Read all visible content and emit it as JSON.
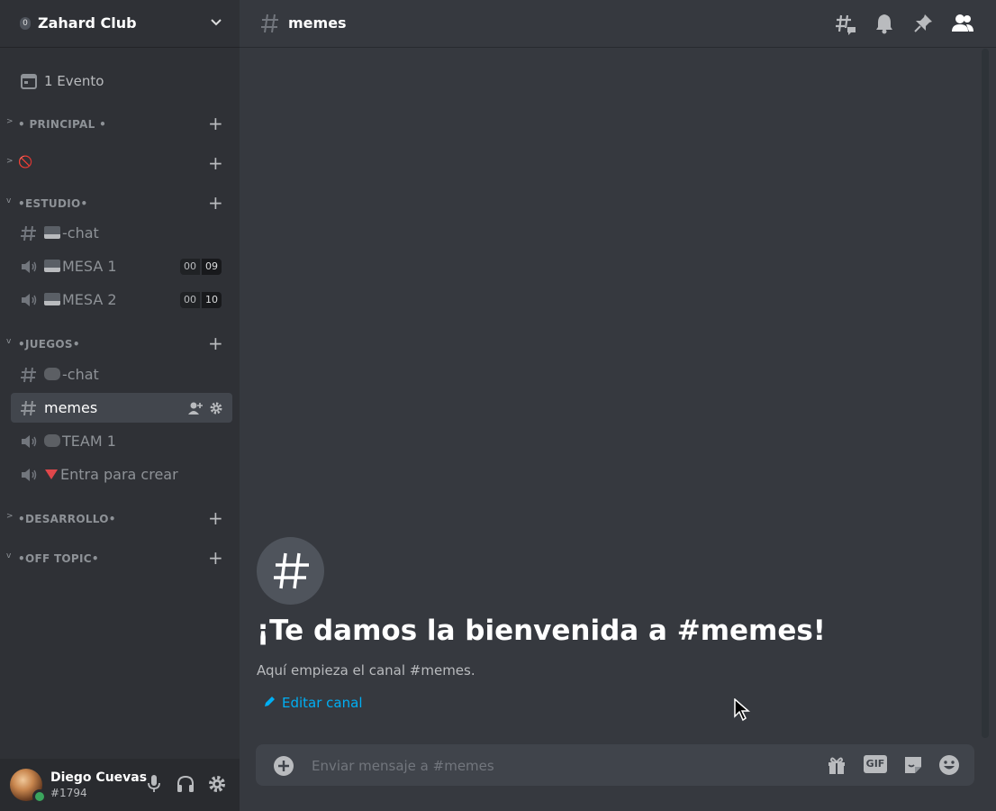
{
  "server": {
    "name": "Zahard Club",
    "badge": "0"
  },
  "events": {
    "label": "1 Evento"
  },
  "categories": {
    "principal": "• PRINCIPAL •",
    "blocked": "🚫",
    "estudio": "•ESTUDIO•",
    "juegos": "•JUEGOS•",
    "desarrollo": "•DESARROLLO•",
    "offtopic": "•OFF TOPIC•"
  },
  "channels": {
    "estudio_chat": "-chat",
    "mesa1": "MESA 1",
    "mesa1_counts": [
      "00",
      "09"
    ],
    "mesa2": "MESA 2",
    "mesa2_counts": [
      "00",
      "10"
    ],
    "juegos_chat": "-chat",
    "memes": "memes",
    "team1": "TEAM 1",
    "entra": "Entra para crear"
  },
  "user": {
    "name": "Diego Cuevas",
    "tag": "#1794",
    "status_color": "#3ba55d"
  },
  "header": {
    "channel": "memes"
  },
  "welcome": {
    "symbol": "#",
    "title": "¡Te damos la bienvenida a #memes!",
    "subtitle": "Aquí empieza el canal #memes.",
    "edit_label": "Editar canal"
  },
  "composer": {
    "placeholder": "Enviar mensaje a #memes",
    "gif_label": "GIF"
  },
  "colors": {
    "sidebar": "#2f3136",
    "main": "#36393f",
    "accent_link": "#00aff4",
    "active_channel": "#42464d"
  }
}
